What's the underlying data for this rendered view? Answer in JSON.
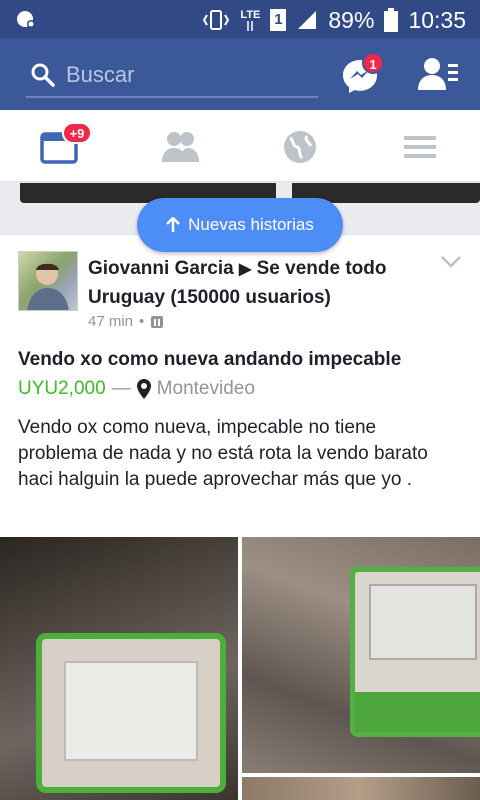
{
  "status_bar": {
    "network_label": "LTE",
    "sim_label": "1",
    "battery": "89%",
    "time": "10:35"
  },
  "top_bar": {
    "search_placeholder": "Buscar",
    "messenger_badge": "1"
  },
  "tabs": {
    "news_feed_badge": "+9"
  },
  "new_stories_label": "Nuevas historias",
  "post": {
    "author": "Giovanni Garcia",
    "group": "Se vende todo Uruguay (150000 usuarios)",
    "time_ago": "47 min",
    "meta_separator": "•",
    "listing_title": "Vendo xo como nueva andando impecable",
    "price": "UYU2,000",
    "dash": "—",
    "location": "Montevideo",
    "body": "Vendo ox como nueva, impecable no tiene problema de nada y no está  rota la vendo barato haci halguin la puede aprovechar más que yo ."
  },
  "colors": {
    "brand_blue": "#3b5998",
    "status_blue": "#314a86",
    "badge_red": "#f02849",
    "price_green": "#42b72a",
    "new_stories_blue": "#4c8ef5"
  }
}
